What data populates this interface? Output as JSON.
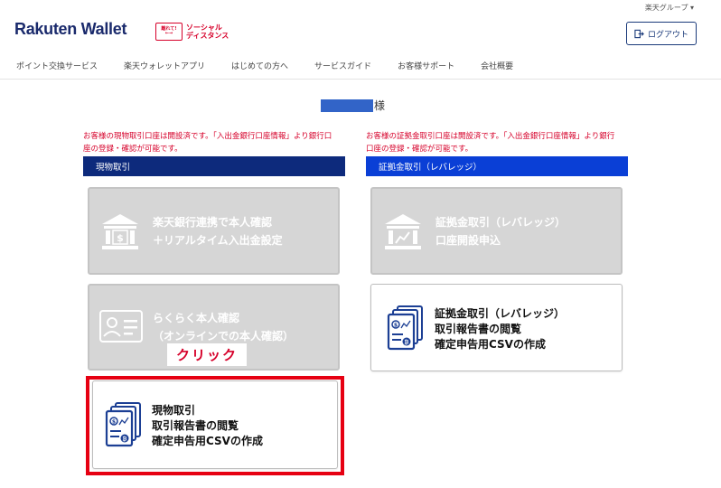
{
  "header": {
    "group_link": "楽天グループ ▾",
    "logo": "Rakuten Wallet",
    "social_badge": {
      "icon_line1": "離れて!",
      "icon_line2": "←→",
      "line1": "ソーシャル",
      "line2": "ディスタンス"
    },
    "logout_label": "ログアウト",
    "nav": [
      "ポイント交換サービス",
      "楽天ウォレットアプリ",
      "はじめての方へ",
      "サービスガイド",
      "お客様サポート",
      "会社概要"
    ]
  },
  "user": {
    "suffix": "様"
  },
  "spot": {
    "notice_line1": "お客様の現物取引口座は開設済です。「入出金銀行口座情報」より銀行口",
    "notice_line2": "座の登録・確認が可能です。",
    "title": "現物取引",
    "cards": [
      {
        "line1": "楽天銀行連携で本人確認",
        "line2": "＋リアルタイム入出金設定"
      },
      {
        "line1": "らくらく本人確認",
        "line2": "（オンラインでの本人確認）"
      },
      {
        "line1": "現物取引",
        "line2": "取引報告書の閲覧",
        "line3": "確定申告用CSVの作成"
      }
    ]
  },
  "margin": {
    "notice_line1": "お客様の証拠金取引口座は開設済です。「入出金銀行口座情報」より銀行",
    "notice_line2": "口座の登録・確認が可能です。",
    "title": "証拠金取引（レバレッジ）",
    "cards": [
      {
        "line1": "証拠金取引（レバレッジ）",
        "line2": "口座開設申込"
      },
      {
        "line1": "証拠金取引（レバレッジ）",
        "line2": "取引報告書の閲覧",
        "line3": "確定申告用CSVの作成"
      }
    ]
  },
  "annotation": {
    "click_label": "クリック"
  },
  "colors": {
    "spot_bar": "#0d2a7c",
    "margin_bar": "#0a3fd6",
    "notice": "#d6002a",
    "highlight": "#e60012",
    "icon_blue": "#1c3f94"
  }
}
